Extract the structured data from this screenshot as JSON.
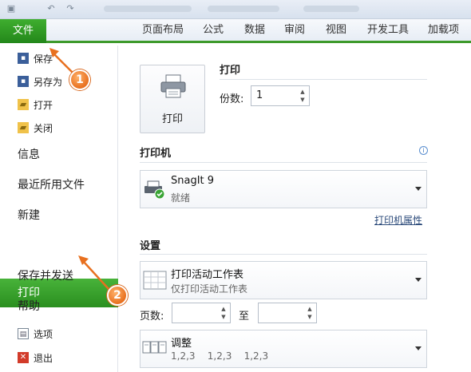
{
  "ribbon": {
    "file_tab": "文件",
    "tabs": [
      "页面布局",
      "公式",
      "数据",
      "审阅",
      "视图",
      "开发工具",
      "加载项"
    ]
  },
  "sidebar": {
    "small_items": [
      {
        "label": "保存",
        "icon": "save-icon"
      },
      {
        "label": "另存为",
        "icon": "save-as-icon"
      },
      {
        "label": "打开",
        "icon": "open-folder-icon"
      },
      {
        "label": "关闭",
        "icon": "close-folder-icon"
      }
    ],
    "big_items": [
      "信息",
      "最近所用文件",
      "新建",
      "打印",
      "保存并发送",
      "帮助"
    ],
    "selected": "打印",
    "bottom_items": [
      {
        "label": "选项",
        "icon": "options-icon"
      },
      {
        "label": "退出",
        "icon": "exit-icon"
      }
    ]
  },
  "print_panel": {
    "print_button_label": "打印",
    "heading": "打印",
    "copies_label": "份数:",
    "copies_value": "1",
    "printer_heading": "打印机",
    "printer_name": "SnagIt 9",
    "printer_status": "就绪",
    "printer_properties_link": "打印机属性",
    "settings_heading": "设置",
    "print_what_title": "打印活动工作表",
    "print_what_sub": "仅打印活动工作表",
    "pages_label": "页数:",
    "to_label": "至",
    "collate_title": "调整",
    "collate_sub": "1,2,3    1,2,3    1,2,3"
  },
  "callouts": [
    "1",
    "2"
  ],
  "colors": {
    "accent_green": "#2a8f1f",
    "callout_orange": "#e8701f"
  }
}
